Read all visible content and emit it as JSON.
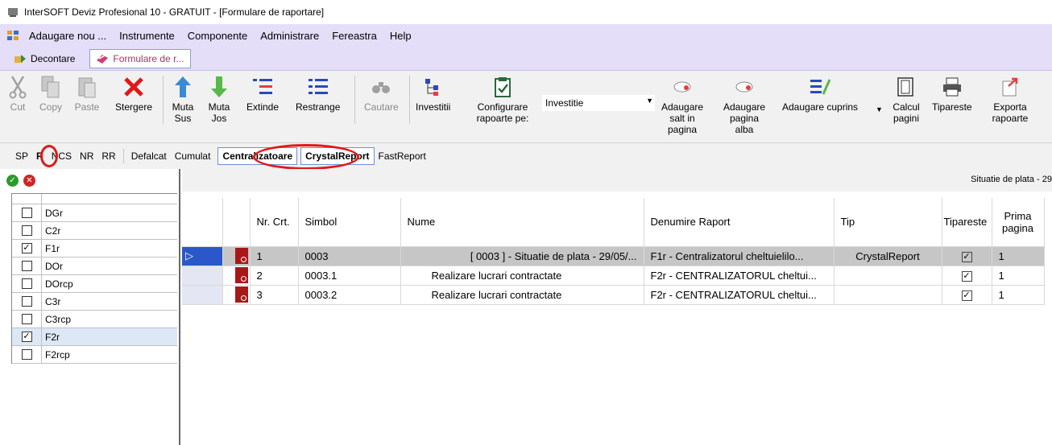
{
  "window": {
    "title": "InterSOFT Deviz Profesional 10 - GRATUIT - [Formulare de raportare]"
  },
  "menu": {
    "items": [
      "Adaugare nou ...",
      "Instrumente",
      "Componente",
      "Administrare",
      "Fereastra",
      "Help"
    ]
  },
  "mdi_tabs": [
    {
      "label": "Decontare",
      "active": false
    },
    {
      "label": "Formulare de r...",
      "active": true
    }
  ],
  "ribbon": {
    "cut": "Cut",
    "copy": "Copy",
    "paste": "Paste",
    "delete": "Stergere",
    "move_up": "Muta Sus",
    "move_down": "Muta Jos",
    "expand": "Extinde",
    "collapse": "Restrange",
    "search": "Cautare",
    "investments": "Investitii",
    "configure": "Configurare rapoarte pe:",
    "combo_value": "Investitie",
    "add_break": "Adaugare salt in pagina",
    "add_blank": "Adaugare pagina alba",
    "add_toc": "Adaugare cuprins",
    "calc_pages": "Calcul pagini",
    "print": "Tipareste",
    "export": "Exporta rapoarte"
  },
  "filters": {
    "items": [
      "SP",
      "R",
      "NCS",
      "NR",
      "RR"
    ],
    "defalcat": "Defalcat",
    "cumulat": "Cumulat",
    "centralizatoare": "Centralizatoare",
    "crystal": "CrystalReport",
    "fast": "FastReport"
  },
  "left_list": [
    {
      "name": "DGr",
      "checked": false
    },
    {
      "name": "C2r",
      "checked": false
    },
    {
      "name": "F1r",
      "checked": true
    },
    {
      "name": "DOr",
      "checked": false
    },
    {
      "name": "DOrcp",
      "checked": false
    },
    {
      "name": "C3r",
      "checked": false
    },
    {
      "name": "C3rcp",
      "checked": false
    },
    {
      "name": "F2r",
      "checked": true
    },
    {
      "name": "F2rcp",
      "checked": false
    }
  ],
  "grid": {
    "caption": "Situatie de plata - 29",
    "columns": [
      "Nr. Crt.",
      "Simbol",
      "Nume",
      "Denumire Raport",
      "Tip",
      "Tipareste",
      "Prima pagina"
    ],
    "rows": [
      {
        "nr": "1",
        "simbol": "0003",
        "nume": "[ 0003 ] - Situatie de plata - 29/05/...",
        "denumire": "F1r - Centralizatorul cheltuielilo...",
        "tip": "CrystalReport",
        "tipareste": true,
        "prima": "1",
        "selected": true
      },
      {
        "nr": "2",
        "simbol": "0003.1",
        "nume": "Realizare lucrari contractate",
        "denumire": "F2r - CENTRALIZATORUL cheltui...",
        "tip": "",
        "tipareste": true,
        "prima": "1",
        "selected": false
      },
      {
        "nr": "3",
        "simbol": "0003.2",
        "nume": "Realizare lucrari contractate",
        "denumire": "F2r - CENTRALIZATORUL cheltui...",
        "tip": "",
        "tipareste": true,
        "prima": "1",
        "selected": false
      }
    ]
  }
}
